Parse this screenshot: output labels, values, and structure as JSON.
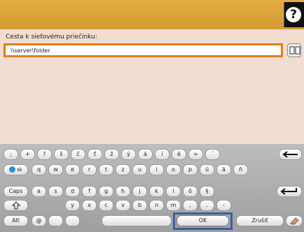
{
  "header": {
    "help_glyph": "?"
  },
  "form": {
    "label": "Cesta k sieťovému priečinku:",
    "path_value": "\\\\server\\folder"
  },
  "keyboard": {
    "row1": [
      ";",
      "+",
      "ľ",
      "š",
      "č",
      "ť",
      "ž",
      "ý",
      "á",
      "í",
      "é",
      "=",
      "´"
    ],
    "row2": [
      "q",
      "w",
      "e",
      "r",
      "t",
      "z",
      "u",
      "i",
      "o",
      "p",
      "ú",
      "ä",
      "ň"
    ],
    "row3": [
      "a",
      "s",
      "d",
      "f",
      "g",
      "h",
      "j",
      "k",
      "l",
      "ô",
      "§"
    ],
    "row4": [
      "y",
      "x",
      "c",
      "v",
      "b",
      "n",
      "m",
      ",",
      ".",
      "-"
    ],
    "lang_label": "sk",
    "caps_label": "Caps",
    "alt_label": "Alt",
    "at_label": "@",
    "ok_label": "OK",
    "cancel_label": "Zrušiť"
  },
  "colors": {
    "accent": "#e07d1e",
    "topbar": "#d69a33",
    "focus": "#3a5f9e"
  }
}
